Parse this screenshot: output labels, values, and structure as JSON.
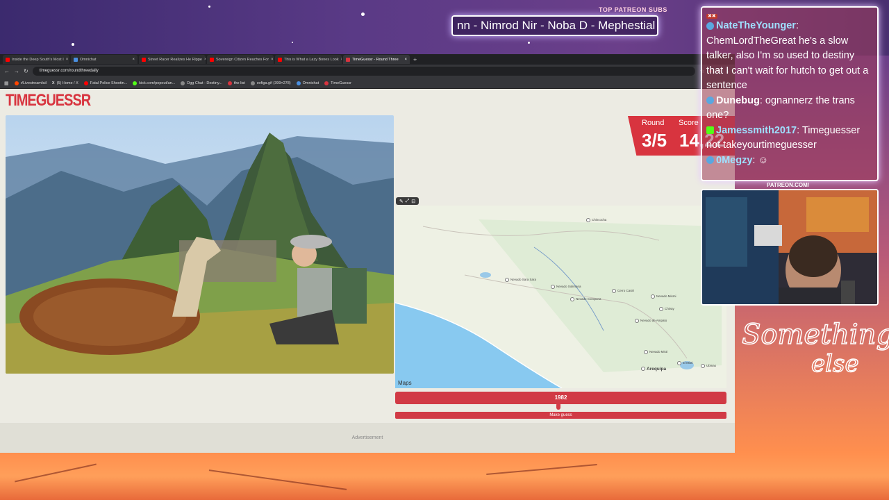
{
  "overlay": {
    "patreon_label": "TOP PATREON SUBS",
    "ticker_text": "nn - Nimrod Nir - Noba D - Mephestial",
    "patreon_small": "PATREON.COM/",
    "signature_line1": "Something",
    "signature_line2": "else"
  },
  "browser": {
    "tabs": [
      {
        "label": "Inside the Deep South's Most I",
        "color": "#ff0000"
      },
      {
        "label": "Omnichat",
        "color": "#4a90e2"
      },
      {
        "label": "Street Racer Realizes He Rippe",
        "color": "#ff0000"
      },
      {
        "label": "Sovereign Citizen Reaches For",
        "color": "#ff0000"
      },
      {
        "label": "This is What a Lazy Bones Look",
        "color": "#ff0000"
      },
      {
        "label": "TimeGuessr - Round Three",
        "color": "#d8343f"
      }
    ],
    "url": "timeguessr.com/roundthreedaily",
    "bookmarks": [
      {
        "label": "r/Livestreamfail",
        "color": "#ff4500"
      },
      {
        "label": "(5) Home / X",
        "color": "#ffffff"
      },
      {
        "label": "Fatal Police Shootin...",
        "color": "#ff0000"
      },
      {
        "label": "kick.com/popout/an...",
        "color": "#53fc18"
      },
      {
        "label": "Dgg Chat - Destiny...",
        "color": "#888888"
      },
      {
        "label": "the list",
        "color": "#d8343f"
      },
      {
        "label": "exfiga.gif (399×278)",
        "color": "#888888"
      },
      {
        "label": "Omnichat",
        "color": "#4a90e2"
      },
      {
        "label": "TimeGuessr",
        "color": "#d8343f"
      }
    ]
  },
  "game": {
    "logo": "TIMEGUESSR",
    "round_label": "Round",
    "round_value": "3/5",
    "score_label": "Score",
    "score_value": "14,22",
    "map_logo": "Maps",
    "year_value": "1982",
    "guess_label": "Make guess",
    "ad_label": "Advertisement",
    "places": [
      {
        "name": "Chincocha"
      },
      {
        "name": "Nevado Sara Sara"
      },
      {
        "name": "Nevado Solimana"
      },
      {
        "name": "Nevado Coropuna"
      },
      {
        "name": "Cerro Casiri"
      },
      {
        "name": "Nevado Mismi"
      },
      {
        "name": "Nevado de Ampato"
      },
      {
        "name": "Chivay"
      },
      {
        "name": "Nevado Misti"
      },
      {
        "name": "Arequipa"
      },
      {
        "name": "El Misti"
      },
      {
        "name": "Ubinas"
      }
    ]
  },
  "chat": {
    "header": "",
    "messages": [
      {
        "user": "NateTheYounger",
        "color": "#9fe0ff",
        "text": "ChemLordTheGreat he's a slow talker, also I'm so used to destiny that I can't wait for hutch to get out a sentence"
      },
      {
        "user": "Dunebug",
        "color": "#ffffff",
        "text": "ognannerz the trans one?"
      },
      {
        "user": "Jamessmith2017",
        "color": "#9fe0ff",
        "text": "Timeguesser not takeyourtimeguesser"
      },
      {
        "user": "0Megzy",
        "color": "#9fe0ff",
        "text": ""
      }
    ]
  }
}
